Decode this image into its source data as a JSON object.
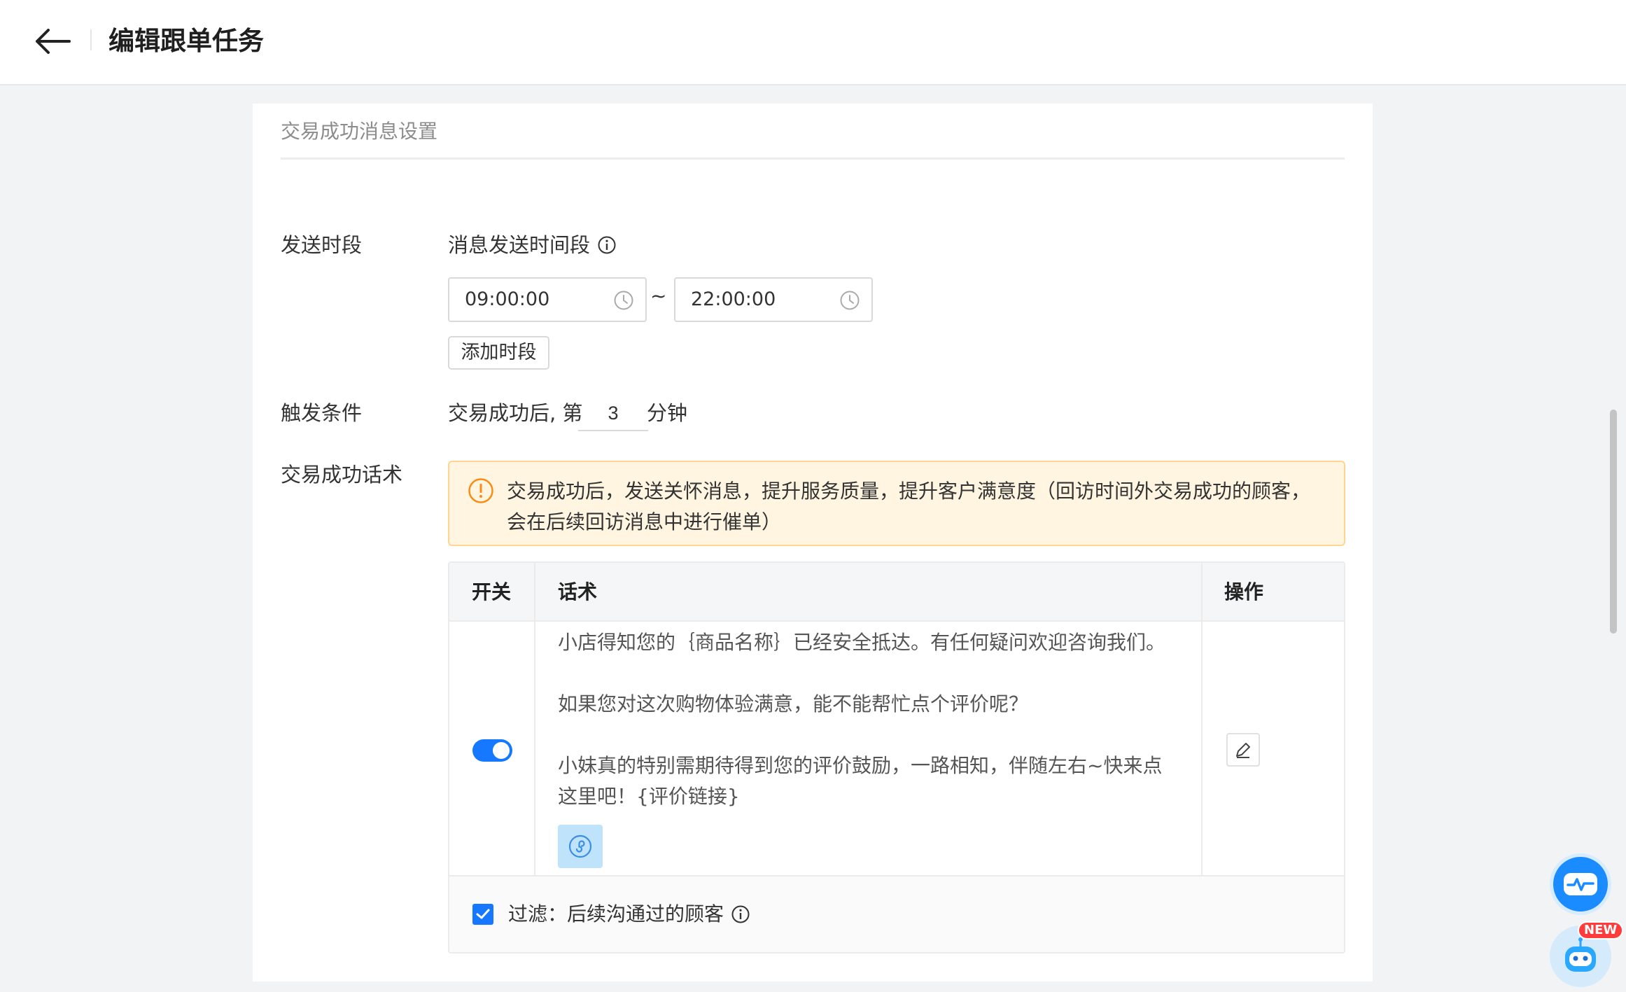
{
  "header": {
    "title": "编辑跟单任务"
  },
  "section": {
    "title": "交易成功消息设置"
  },
  "send_period": {
    "label": "发送时段",
    "field_label": "消息发送时间段",
    "start_time": "09:00:00",
    "separator": "~",
    "end_time": "22:00:00",
    "add_button": "添加时段"
  },
  "trigger": {
    "label": "触发条件",
    "prefix": "交易成功后, 第",
    "value": "3",
    "suffix": "分钟"
  },
  "script_section": {
    "label": "交易成功话术",
    "alert_line1": "交易成功后，发送关怀消息，提升服务质量，提升客户满意度（回访时间外交易成功的顾客，",
    "alert_line2": "会在后续回访消息中进行催单）"
  },
  "table": {
    "headers": {
      "switch": "开关",
      "script": "话术",
      "action": "操作"
    },
    "row": {
      "enabled": true,
      "paragraphs": [
        "小店得知您的｛商品名称｝已经安全抵达。有任何疑问欢迎咨询我们。",
        "如果您对这次购物体验满意，能不能帮忙点个评价呢？",
        "小妹真的特别需期待得到您的评价鼓励，一路相知，伴随左右~快来点这里吧！{评价链接}"
      ]
    },
    "filter": {
      "checked": true,
      "label": "过滤：后续沟通过的顾客"
    }
  },
  "floating": {
    "badge": "NEW"
  },
  "colors": {
    "primary": "#1677ff",
    "warning_bg": "#fff5e0",
    "warning_border": "#ffd591",
    "warning_icon": "#fa8c16"
  }
}
